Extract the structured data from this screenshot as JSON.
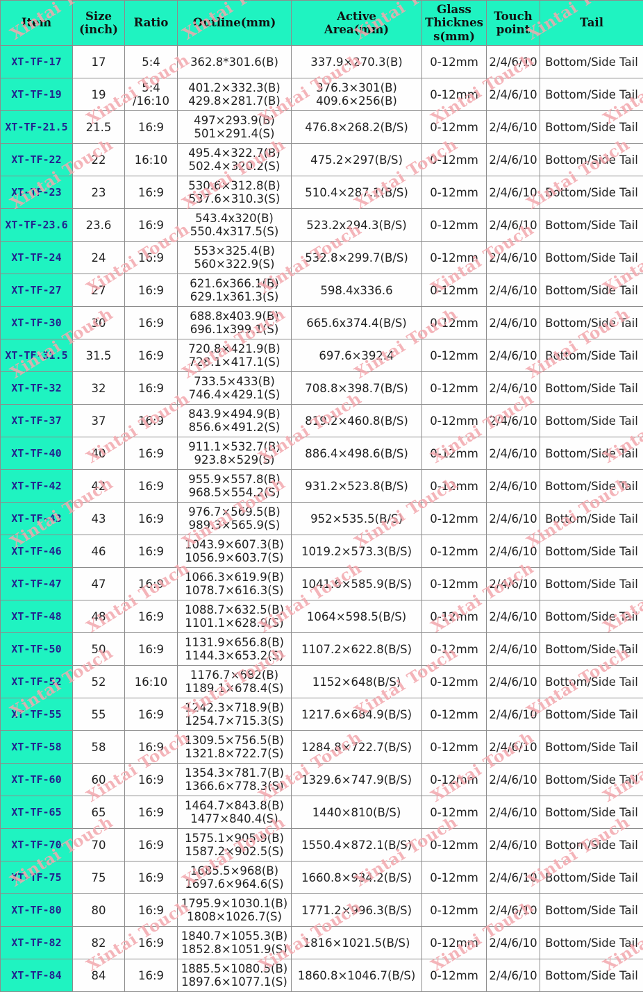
{
  "table": {
    "columns": [
      {
        "key": "item",
        "label": "Item"
      },
      {
        "key": "size",
        "label": "Size\n(inch)",
        "label_l1": "Size",
        "label_l2": "(inch)"
      },
      {
        "key": "ratio",
        "label": "Ratio"
      },
      {
        "key": "outline",
        "label": "Outline(mm)"
      },
      {
        "key": "active",
        "label": "Active\nArea(mm)",
        "label_l1": "Active",
        "label_l2": "Area(mm)"
      },
      {
        "key": "glass",
        "label": "Glass Thickness(mm)",
        "label_l1": "Glass",
        "label_l2": "Thicknes",
        "label_l3": "s(mm)"
      },
      {
        "key": "touch",
        "label": "Touch point",
        "label_l1": "Touch",
        "label_l2": "point"
      },
      {
        "key": "tail",
        "label": "Tail"
      }
    ],
    "rows": [
      {
        "item": "XT-TF-17",
        "size": "17",
        "ratio": "5:4",
        "ratio_l2": "",
        "outline_l1": "362.8*301.6(B)",
        "outline_l2": "",
        "active_l1": "337.9×270.3(B)",
        "active_l2": "",
        "glass": "0-12mm",
        "touch": "2/4/6/10",
        "tail": "Bottom/Side Tail"
      },
      {
        "item": "XT-TF-19",
        "size": "19",
        "ratio": "5:4",
        "ratio_l2": "/16:10",
        "outline_l1": "401.2×332.3(B)",
        "outline_l2": "429.8×281.7(B)",
        "active_l1": "376.3×301(B)",
        "active_l2": "409.6×256(B)",
        "glass": "0-12mm",
        "touch": "2/4/6/10",
        "tail": "Bottom/Side Tail"
      },
      {
        "item": "XT-TF-21.5",
        "size": "21.5",
        "ratio": "16:9",
        "ratio_l2": "",
        "outline_l1": "497×293.9(B)",
        "outline_l2": "501×291.4(S)",
        "active_l1": "476.8×268.2(B/S)",
        "active_l2": "",
        "glass": "0-12mm",
        "touch": "2/4/6/10",
        "tail": "Bottom/Side Tail"
      },
      {
        "item": "XT-TF-22",
        "size": "22",
        "ratio": "16:10",
        "ratio_l2": "",
        "outline_l1": "495.4×322.7(B)",
        "outline_l2": "502.4×320.2(S)",
        "active_l1": "475.2×297(B/S)",
        "active_l2": "",
        "glass": "0-12mm",
        "touch": "2/4/6/10",
        "tail": "Bottom/Side Tail"
      },
      {
        "item": "XT-TF-23",
        "size": "23",
        "ratio": "16:9",
        "ratio_l2": "",
        "outline_l1": "530.6×312.8(B)",
        "outline_l2": "537.6×310.3(S)",
        "active_l1": "510.4×287.1(B/S)",
        "active_l2": "",
        "glass": "0-12mm",
        "touch": "2/4/6/10",
        "tail": "Bottom/Side Tail"
      },
      {
        "item": "XT-TF-23.6",
        "size": "23.6",
        "ratio": "16:9",
        "ratio_l2": "",
        "outline_l1": "543.4x320(B)",
        "outline_l2": "550.4x317.5(S)",
        "active_l1": "523.2x294.3(B/S)",
        "active_l2": "",
        "glass": "0-12mm",
        "touch": "2/4/6/10",
        "tail": "Bottom/Side Tail"
      },
      {
        "item": "XT-TF-24",
        "size": "24",
        "ratio": "16:9",
        "ratio_l2": "",
        "outline_l1": "553×325.4(B)",
        "outline_l2": "560×322.9(S)",
        "active_l1": "532.8×299.7(B/S)",
        "active_l2": "",
        "glass": "0-12mm",
        "touch": "2/4/6/10",
        "tail": "Bottom/Side Tail"
      },
      {
        "item": "XT-TF-27",
        "size": "27",
        "ratio": "16:9",
        "ratio_l2": "",
        "outline_l1": "621.6x366.1(B)",
        "outline_l2": "629.1x361.3(S)",
        "active_l1": "598.4x336.6",
        "active_l2": "",
        "glass": "0-12mm",
        "touch": "2/4/6/10",
        "tail": "Bottom/Side Tail"
      },
      {
        "item": "XT-TF-30",
        "size": "30",
        "ratio": "16:9",
        "ratio_l2": "",
        "outline_l1": "688.8x403.9(B)",
        "outline_l2": "696.1x399.1(S)",
        "active_l1": "665.6x374.4(B/S)",
        "active_l2": "",
        "glass": "0-12mm",
        "touch": "2/4/6/10",
        "tail": "Bottom/Side Tail"
      },
      {
        "item": "XT-TF-31.5",
        "size": "31.5",
        "ratio": "16:9",
        "ratio_l2": "",
        "outline_l1": "720.8×421.9(B)",
        "outline_l2": "728.1×417.1(S)",
        "active_l1": "697.6×392.4",
        "active_l2": "",
        "glass": "0-12mm",
        "touch": "2/4/6/10",
        "tail": "Bottom/Side Tail"
      },
      {
        "item": "XT-TF-32",
        "size": "32",
        "ratio": "16:9",
        "ratio_l2": "",
        "outline_l1": "733.5×433(B)",
        "outline_l2": "746.4×429.1(S)",
        "active_l1": "708.8×398.7(B/S)",
        "active_l2": "",
        "glass": "0-12mm",
        "touch": "2/4/6/10",
        "tail": "Bottom/Side Tail"
      },
      {
        "item": "XT-TF-37",
        "size": "37",
        "ratio": "16:9",
        "ratio_l2": "",
        "outline_l1": "843.9×494.9(B)",
        "outline_l2": "856.6×491.2(S)",
        "active_l1": "819.2×460.8(B/S)",
        "active_l2": "",
        "glass": "0-12mm",
        "touch": "2/4/6/10",
        "tail": "Bottom/Side Tail"
      },
      {
        "item": "XT-TF-40",
        "size": "40",
        "ratio": "16:9",
        "ratio_l2": "",
        "outline_l1": "911.1×532.7(B)",
        "outline_l2": "923.8×529(S)",
        "active_l1": "886.4×498.6(B/S)",
        "active_l2": "",
        "glass": "0-12mm",
        "touch": "2/4/6/10",
        "tail": "Bottom/Side Tail"
      },
      {
        "item": "XT-TF-42",
        "size": "42",
        "ratio": "16:9",
        "ratio_l2": "",
        "outline_l1": "955.9×557.8(B)",
        "outline_l2": "968.5×554.2(S)",
        "active_l1": "931.2×523.8(B/S)",
        "active_l2": "",
        "glass": "0-12mm",
        "touch": "2/4/6/10",
        "tail": "Bottom/Side Tail"
      },
      {
        "item": "XT-TF-43",
        "size": "43",
        "ratio": "16:9",
        "ratio_l2": "",
        "outline_l1": "976.7×569.5(B)",
        "outline_l2": "989.3×565.9(S)",
        "active_l1": "952×535.5(B/S)",
        "active_l2": "",
        "glass": "0-12mm",
        "touch": "2/4/6/10",
        "tail": "Bottom/Side Tail"
      },
      {
        "item": "XT-TF-46",
        "size": "46",
        "ratio": "16:9",
        "ratio_l2": "",
        "outline_l1": "1043.9×607.3(B)",
        "outline_l2": "1056.9×603.7(S)",
        "active_l1": "1019.2×573.3(B/S)",
        "active_l2": "",
        "glass": "0-12mm",
        "touch": "2/4/6/10",
        "tail": "Bottom/Side Tail"
      },
      {
        "item": "XT-TF-47",
        "size": "47",
        "ratio": "16:9",
        "ratio_l2": "",
        "outline_l1": "1066.3×619.9(B)",
        "outline_l2": "1078.7×616.3(S)",
        "active_l1": "1041.6×585.9(B/S)",
        "active_l2": "",
        "glass": "0-12mm",
        "touch": "2/4/6/10",
        "tail": "Bottom/Side Tail"
      },
      {
        "item": "XT-TF-48",
        "size": "48",
        "ratio": "16:9",
        "ratio_l2": "",
        "outline_l1": "1088.7×632.5(B)",
        "outline_l2": "1101.1×628.9(S)",
        "active_l1": "1064×598.5(B/S)",
        "active_l2": "",
        "glass": "0-12mm",
        "touch": "2/4/6/10",
        "tail": "Bottom/Side Tail"
      },
      {
        "item": "XT-TF-50",
        "size": "50",
        "ratio": "16:9",
        "ratio_l2": "",
        "outline_l1": "1131.9×656.8(B)",
        "outline_l2": "1144.3×653.2(S)",
        "active_l1": "1107.2×622.8(B/S)",
        "active_l2": "",
        "glass": "0-12mm",
        "touch": "2/4/6/10",
        "tail": "Bottom/Side Tail"
      },
      {
        "item": "XT-TF-52",
        "size": "52",
        "ratio": "16:10",
        "ratio_l2": "",
        "outline_l1": "1176.7×682(B)",
        "outline_l2": "1189.1×678.4(S)",
        "active_l1": "1152×648(B/S)",
        "active_l2": "",
        "glass": "0-12mm",
        "touch": "2/4/6/10",
        "tail": "Bottom/Side Tail"
      },
      {
        "item": "XT-TF-55",
        "size": "55",
        "ratio": "16:9",
        "ratio_l2": "",
        "outline_l1": "1242.3×718.9(B)",
        "outline_l2": "1254.7×715.3(S)",
        "active_l1": "1217.6×684.9(B/S)",
        "active_l2": "",
        "glass": "0-12mm",
        "touch": "2/4/6/10",
        "tail": "Bottom/Side Tail"
      },
      {
        "item": "XT-TF-58",
        "size": "58",
        "ratio": "16:9",
        "ratio_l2": "",
        "outline_l1": "1309.5×756.5(B)",
        "outline_l2": "1321.8×722.7(S)",
        "active_l1": "1284.8×722.7(B/S)",
        "active_l2": "",
        "glass": "0-12mm",
        "touch": "2/4/6/10",
        "tail": "Bottom/Side Tail"
      },
      {
        "item": "XT-TF-60",
        "size": "60",
        "ratio": "16:9",
        "ratio_l2": "",
        "outline_l1": "1354.3×781.7(B)",
        "outline_l2": "1366.6×778.3(S)",
        "active_l1": "1329.6×747.9(B/S)",
        "active_l2": "",
        "glass": "0-12mm",
        "touch": "2/4/6/10",
        "tail": "Bottom/Side Tail"
      },
      {
        "item": "XT-TF-65",
        "size": "65",
        "ratio": "16:9",
        "ratio_l2": "",
        "outline_l1": "1464.7×843.8(B)",
        "outline_l2": "1477×840.4(S)",
        "active_l1": "1440×810(B/S)",
        "active_l2": "",
        "glass": "0-12mm",
        "touch": "2/4/6/10",
        "tail": "Bottom/Side Tail"
      },
      {
        "item": "XT-TF-70",
        "size": "70",
        "ratio": "16:9",
        "ratio_l2": "",
        "outline_l1": "1575.1×905.9(B)",
        "outline_l2": "1587.2×902.5(S)",
        "active_l1": "1550.4×872.1(B/S)",
        "active_l2": "",
        "glass": "0-12mm",
        "touch": "2/4/6/10",
        "tail": "Bottom/Side Tail"
      },
      {
        "item": "XT-TF-75",
        "size": "75",
        "ratio": "16:9",
        "ratio_l2": "",
        "outline_l1": "1685.5×968(B)",
        "outline_l2": "1697.6×964.6(S)",
        "active_l1": "1660.8×934.2(B/S)",
        "active_l2": "",
        "glass": "0-12mm",
        "touch": "2/4/6/10",
        "tail": "Bottom/Side Tail"
      },
      {
        "item": "XT-TF-80",
        "size": "80",
        "ratio": "16:9",
        "ratio_l2": "",
        "outline_l1": "1795.9×1030.1(B)",
        "outline_l2": "1808×1026.7(S)",
        "active_l1": "1771.2×996.3(B/S)",
        "active_l2": "",
        "glass": "0-12mm",
        "touch": "2/4/6/10",
        "tail": "Bottom/Side Tail"
      },
      {
        "item": "XT-TF-82",
        "size": "82",
        "ratio": "16:9",
        "ratio_l2": "",
        "outline_l1": "1840.7×1055.3(B)",
        "outline_l2": "1852.8×1051.9(S)",
        "active_l1": "1816×1021.5(B/S)",
        "active_l2": "",
        "glass": "0-12mm",
        "touch": "2/4/6/10",
        "tail": "Bottom/Side Tail"
      },
      {
        "item": "XT-TF-84",
        "size": "84",
        "ratio": "16:9",
        "ratio_l2": "",
        "outline_l1": "1885.5×1080.5(B)",
        "outline_l2": "1897.6×1077.1(S)",
        "active_l1": "1860.8×1046.7(B/S)",
        "active_l2": "",
        "glass": "0-12mm",
        "touch": "2/4/6/10",
        "tail": "Bottom/Side Tail"
      }
    ]
  },
  "watermark": {
    "text": "Xintai Touch",
    "color": "#f3a8ae",
    "angle_deg": -32
  },
  "colors": {
    "header_bg": "#1ff3c1",
    "item_bg": "#1ff3c1",
    "item_text": "#23238e",
    "cell_bg": "#fefefe",
    "border": "#8c8c8c",
    "body_text": "#222222"
  }
}
